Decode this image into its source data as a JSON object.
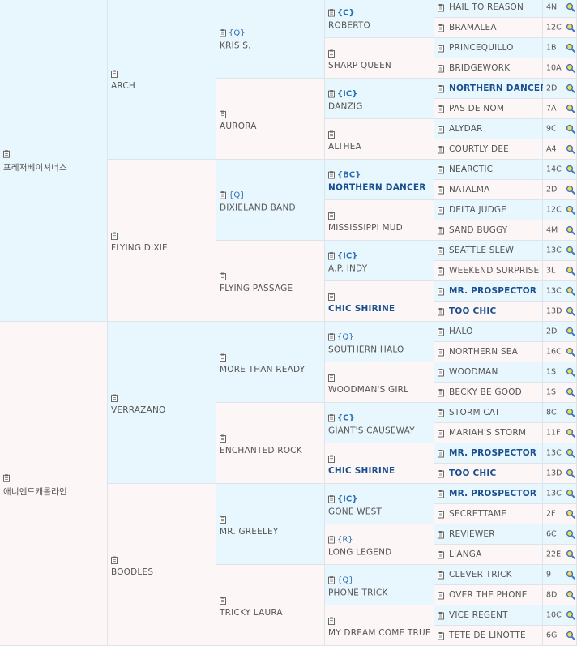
{
  "gen1": [
    {
      "name": "프레저베이셔너스"
    },
    {
      "name": "애니앤드캐롤라인"
    }
  ],
  "gen2": [
    {
      "name": "ARCH"
    },
    {
      "name": "FLYING DIXIE"
    },
    {
      "name": "VERRAZANO"
    },
    {
      "name": "BOODLES"
    }
  ],
  "gen3": [
    {
      "tag": "{Q}",
      "name": "KRIS S."
    },
    {
      "name": "AURORA"
    },
    {
      "tag": "{Q}",
      "name": "DIXIELAND BAND"
    },
    {
      "name": "FLYING PASSAGE"
    },
    {
      "name": "MORE THAN READY"
    },
    {
      "name": "ENCHANTED ROCK"
    },
    {
      "name": "MR. GREELEY"
    },
    {
      "name": "TRICKY LAURA"
    }
  ],
  "gen4": [
    {
      "tag": "{C}",
      "name": "ROBERTO"
    },
    {
      "name": "SHARP QUEEN"
    },
    {
      "tag": "{IC}",
      "name": "DANZIG"
    },
    {
      "name": "ALTHEA"
    },
    {
      "tag": "{BC}",
      "name": "NORTHERN DANCER",
      "hl": true
    },
    {
      "name": "MISSISSIPPI MUD"
    },
    {
      "tag": "{IC}",
      "name": "A.P. INDY"
    },
    {
      "name": "CHIC SHIRINE",
      "hl": true
    },
    {
      "tag": "{Q}",
      "name": "SOUTHERN HALO"
    },
    {
      "name": "WOODMAN'S GIRL"
    },
    {
      "tag": "{C}",
      "name": "GIANT'S CAUSEWAY"
    },
    {
      "name": "CHIC SHIRINE",
      "hl": true
    },
    {
      "tag": "{IC}",
      "name": "GONE WEST"
    },
    {
      "tag": "{R}",
      "name": "LONG LEGEND"
    },
    {
      "tag": "{Q}",
      "name": "PHONE TRICK"
    },
    {
      "name": "MY DREAM COME TRUE"
    }
  ],
  "gen5": [
    {
      "name": "HAIL TO REASON",
      "code": "4N"
    },
    {
      "name": "BRAMALEA",
      "code": "12C"
    },
    {
      "name": "PRINCEQUILLO",
      "code": "1B"
    },
    {
      "name": "BRIDGEWORK",
      "code": "10A"
    },
    {
      "name": "NORTHERN DANCER",
      "code": "2D",
      "hl": true
    },
    {
      "name": "PAS DE NOM",
      "code": "7A"
    },
    {
      "name": "ALYDAR",
      "code": "9C"
    },
    {
      "name": "COURTLY DEE",
      "code": "A4"
    },
    {
      "name": "NEARCTIC",
      "code": "14C"
    },
    {
      "name": "NATALMA",
      "code": "2D"
    },
    {
      "name": "DELTA JUDGE",
      "code": "12C"
    },
    {
      "name": "SAND BUGGY",
      "code": "4M"
    },
    {
      "name": "SEATTLE SLEW",
      "code": "13C"
    },
    {
      "name": "WEEKEND SURPRISE",
      "code": "3L"
    },
    {
      "name": "MR. PROSPECTOR",
      "code": "13C",
      "hl": true
    },
    {
      "name": "TOO CHIC",
      "code": "13D",
      "hl": true
    },
    {
      "name": "HALO",
      "code": "2D"
    },
    {
      "name": "NORTHERN SEA",
      "code": "16C"
    },
    {
      "name": "WOODMAN",
      "code": "1S"
    },
    {
      "name": "BECKY BE GOOD",
      "code": "1S"
    },
    {
      "name": "STORM CAT",
      "code": "8C"
    },
    {
      "name": "MARIAH'S STORM",
      "code": "11F"
    },
    {
      "name": "MR. PROSPECTOR",
      "code": "13C",
      "hl": true
    },
    {
      "name": "TOO CHIC",
      "code": "13D",
      "hl": true
    },
    {
      "name": "MR. PROSPECTOR",
      "code": "13C",
      "hl": true
    },
    {
      "name": "SECRETTAME",
      "code": "2F"
    },
    {
      "name": "REVIEWER",
      "code": "6C"
    },
    {
      "name": "LIANGA",
      "code": "22E"
    },
    {
      "name": "CLEVER TRICK",
      "code": "9"
    },
    {
      "name": "OVER THE PHONE",
      "code": "8D"
    },
    {
      "name": "VICE REGENT",
      "code": "10C"
    },
    {
      "name": "TETE DE LINOTTE",
      "code": "6G"
    }
  ],
  "icons": {
    "clipboard": "clipboard-icon",
    "search": "search-icon"
  },
  "colors": {
    "sire_bg": "#e8f6fd",
    "dam_bg": "#fdf6f6",
    "tag": "#2a6fb5",
    "highlight": "#1a4f8f"
  }
}
